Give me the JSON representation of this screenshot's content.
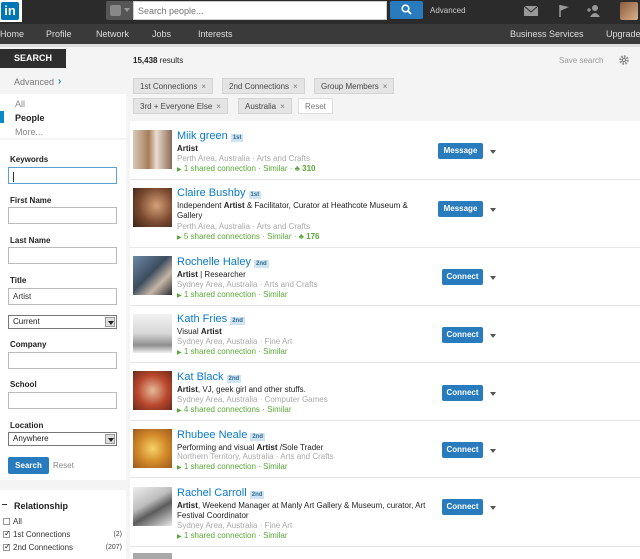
{
  "topbar": {
    "logo": "in",
    "search_placeholder": "Search people...",
    "advanced": "Advanced",
    "icons": [
      "mail-icon",
      "flag-icon",
      "add-connection-icon"
    ]
  },
  "nav": {
    "items": [
      "Home",
      "Profile",
      "Network",
      "Jobs",
      "Interests"
    ],
    "right_items": [
      "Business Services",
      "Upgrade"
    ]
  },
  "sidebar": {
    "tab": "SEARCH",
    "advanced": "Advanced",
    "filter_options": [
      "All",
      "People",
      "More..."
    ],
    "fields": {
      "keywords": {
        "label": "Keywords",
        "value": ""
      },
      "first_name": {
        "label": "First Name",
        "value": ""
      },
      "last_name": {
        "label": "Last Name",
        "value": ""
      },
      "title": {
        "label": "Title",
        "value": "Artist"
      },
      "title_scope": "Current",
      "company": {
        "label": "Company",
        "value": ""
      },
      "school": {
        "label": "School",
        "value": ""
      },
      "location": {
        "label": "Location",
        "value": "Anywhere"
      }
    },
    "search_button": "Search",
    "reset": "Reset",
    "relationship": {
      "title": "Relationship",
      "options": [
        {
          "label": "All",
          "checked": false,
          "count": ""
        },
        {
          "label": "1st Connections",
          "checked": true,
          "count": "(2)"
        },
        {
          "label": "2nd Connections",
          "checked": true,
          "count": "(207)"
        }
      ]
    }
  },
  "main": {
    "count": "15,438",
    "count_suffix": " results",
    "save_search": "Save search",
    "chips": [
      "1st Connections",
      "2nd Connections",
      "Group Members",
      "3rd + Everyone Else",
      "Australia"
    ],
    "chip_reset": "Reset",
    "results": [
      {
        "name": "Miik green",
        "degree": "1st",
        "headline_pre": "",
        "headline_bold": "Artist",
        "headline_post": "",
        "meta": "Perth Area, Australia · Arts and Crafts",
        "shared": "1 shared connection",
        "similar": "Similar",
        "endorse": "310",
        "action": "Message"
      },
      {
        "name": "Claire Bushby",
        "degree": "1st",
        "headline_pre": "Independent ",
        "headline_bold": "Artist",
        "headline_post": " & Facilitator, Curator at Heathcote Museum & Gallery",
        "meta": "Perth Area, Australia · Arts and Crafts",
        "shared": "5 shared connections",
        "similar": "Similar",
        "endorse": "176",
        "action": "Message"
      },
      {
        "name": "Rochelle Haley",
        "degree": "2nd",
        "headline_pre": "",
        "headline_bold": "Artist",
        "headline_post": " | Researcher",
        "meta": "Sydney Area, Australia · Arts and Crafts",
        "shared": "1 shared connection",
        "similar": "Similar",
        "endorse": "",
        "action": "Connect"
      },
      {
        "name": "Kath Fries",
        "degree": "2nd",
        "headline_pre": "Visual ",
        "headline_bold": "Artist",
        "headline_post": "",
        "meta": "Sydney Area, Australia · Fine Art",
        "shared": "1 shared connection",
        "similar": "Similar",
        "endorse": "",
        "action": "Connect"
      },
      {
        "name": "Kat Black",
        "degree": "2nd",
        "headline_pre": "",
        "headline_bold": "Artist",
        "headline_post": ", VJ, geek girl and other stuffs.",
        "meta": "Sydney Area, Australia · Computer Games",
        "shared": "4 shared connections",
        "similar": "Similar",
        "endorse": "",
        "action": "Connect"
      },
      {
        "name": "Rhubee Neale",
        "degree": "2nd",
        "headline_pre": "Performing and visual ",
        "headline_bold": "Artist",
        "headline_post": " /Sole Trader",
        "meta": "Northern Territory, Australia · Arts and Crafts",
        "shared": "1 shared connection",
        "similar": "Similar",
        "endorse": "",
        "action": "Connect"
      },
      {
        "name": "Rachel Carroll",
        "degree": "2nd",
        "headline_pre": "",
        "headline_bold": "Artist",
        "headline_post": ", Weekend Manager at Manly Art Gallery & Museum, curator, Art Festival Coordinator",
        "meta": "Sydney Area, Australia · Fine Art",
        "shared": "1 shared connection",
        "similar": "Similar",
        "endorse": "",
        "action": "Connect"
      }
    ]
  }
}
